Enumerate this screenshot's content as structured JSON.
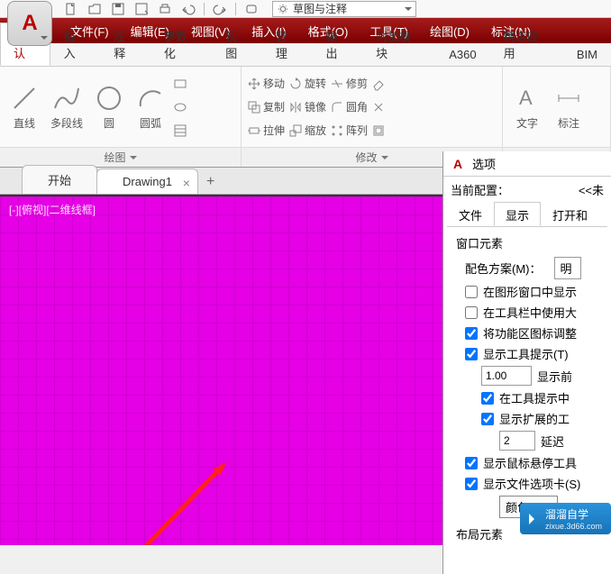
{
  "app_letter": "A",
  "qat": {
    "workspace": "草图与注释"
  },
  "menubar": [
    "文件(F)",
    "编辑(E)",
    "视图(V)",
    "插入(I)",
    "格式(O)",
    "工具(T)",
    "绘图(D)",
    "标注(N)"
  ],
  "ribbon_tabs": [
    "默认",
    "插入",
    "注释",
    "参数化",
    "视图",
    "管理",
    "输出",
    "附加模块",
    "A360",
    "精选应用",
    "BIM"
  ],
  "ribbon_active": 0,
  "panels": {
    "draw": {
      "title": "绘图",
      "tools": [
        {
          "label": "直线"
        },
        {
          "label": "多段线"
        },
        {
          "label": "圆"
        },
        {
          "label": "圆弧"
        }
      ]
    },
    "modify": {
      "title": "修改",
      "rows": {
        "move": "移动",
        "rotate": "旋转",
        "trim": "修剪",
        "copy": "复制",
        "mirror": "镜像",
        "fillet": "圆角",
        "stretch": "拉伸",
        "scale": "缩放",
        "array": "阵列"
      }
    },
    "annot": {
      "text": "文字",
      "dim": "标注"
    }
  },
  "doctabs": {
    "start": "开始",
    "drawing": "Drawing1"
  },
  "viewport_label": "[-][俯视][二维线框]",
  "dialog": {
    "title": "选项",
    "profile_label": "当前配置：",
    "profile_value": "<<未",
    "tabs": [
      "文件",
      "显示",
      "打开和"
    ],
    "active_tab": 1,
    "grp_window": "窗口元素",
    "scheme_label": "配色方案(M)：",
    "scheme_value": "明",
    "chk_scrollbar": "在图形窗口中显示",
    "chk_largeicons": "在工具栏中使用大",
    "chk_ribbonicons": "将功能区图标调整",
    "chk_tooltips": "显示工具提示(T)",
    "tt_delay_val": "1.00",
    "tt_delay_lbl": "显示前",
    "chk_tt_shortcut": "在工具提示中",
    "chk_tt_ext": "显示扩展的工",
    "tt_ext_val": "2",
    "tt_ext_lbl": "延迟",
    "chk_hover": "显示鼠标悬停工具",
    "chk_filetabs": "显示文件选项卡(S)",
    "color_btn": "颜色(C)..",
    "grp_layout": "布局元素"
  },
  "watermark": {
    "brand": "溜溜自学",
    "url": "zixue.3d66.com"
  }
}
